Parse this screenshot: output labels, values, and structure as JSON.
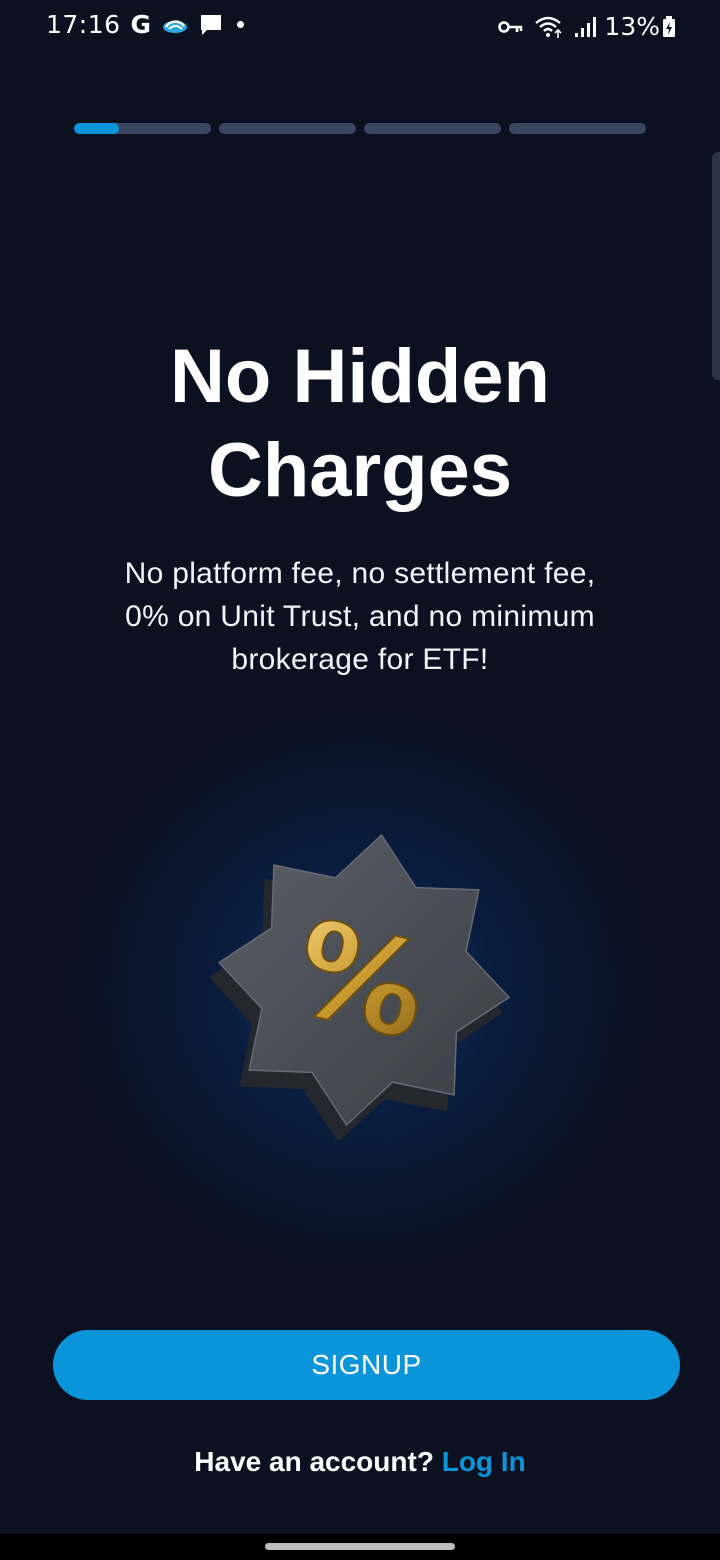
{
  "status_bar": {
    "time": "17:16",
    "google_glyph": "G",
    "battery_percent": "13%",
    "icons": [
      "google-icon",
      "cloud-app-icon",
      "message-icon",
      "notification-dot",
      "vpn-key-icon",
      "wifi-icon",
      "signal-icon",
      "battery-charging-icon"
    ]
  },
  "onboarding": {
    "total_steps": 4,
    "current_step": 1,
    "step_fill_fraction": 0.33,
    "title_line1": "No Hidden",
    "title_line2": "Charges",
    "subtitle_line1": "No platform fee, no settlement fee,",
    "subtitle_line2": "0% on Unit Trust, and no minimum",
    "subtitle_line3": "brokerage for ETF!",
    "illustration": "percent-badge-icon",
    "badge_glyph": "%"
  },
  "actions": {
    "signup_label": "SIGNUP",
    "login_prompt": "Have an account?",
    "login_link": "Log In"
  },
  "colors": {
    "background": "#0b1120",
    "accent": "#0a95db",
    "progress_track": "#3b4660",
    "badge_gold": "#d4a63a"
  }
}
